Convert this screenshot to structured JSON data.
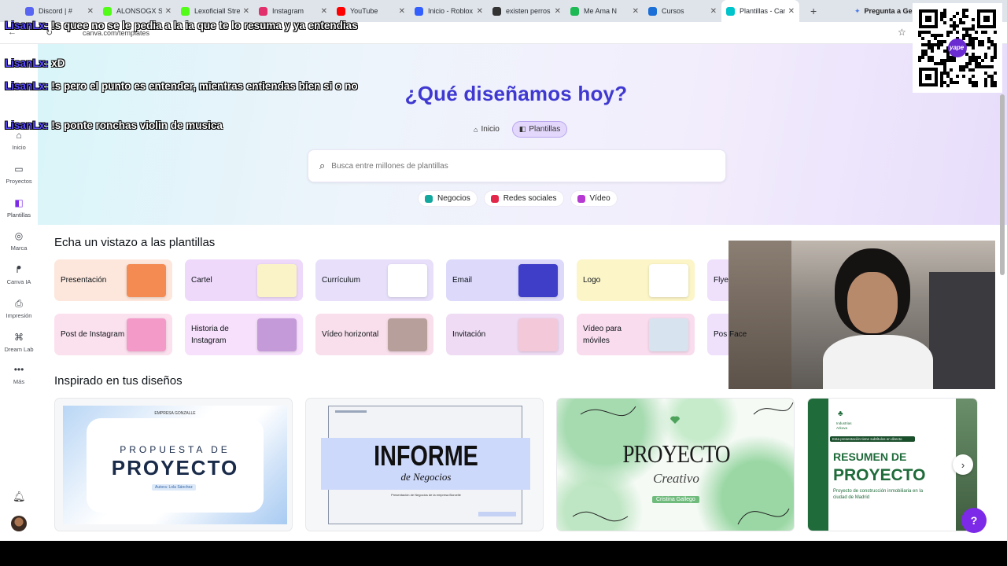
{
  "browser": {
    "tabs": [
      {
        "title": "Discord | #",
        "color": "#5865f2"
      },
      {
        "title": "ALONSOGX St",
        "color": "#53fc18"
      },
      {
        "title": "Lexoficiall Stre",
        "color": "#53fc18"
      },
      {
        "title": "Instagram",
        "color": "#e1306c"
      },
      {
        "title": "YouTube",
        "color": "#ff0000"
      },
      {
        "title": "Inicio - Roblox",
        "color": "#335fff"
      },
      {
        "title": "existen perros",
        "color": "#333333"
      },
      {
        "title": "Me Ama N",
        "color": "#1db954"
      },
      {
        "title": "Cursos",
        "color": "#1b6fd6"
      },
      {
        "title": "Plantillas - Can",
        "color": "#00c4cc"
      }
    ],
    "ask_gemini": "Pregunta a Gem",
    "url": "canva.com/templates"
  },
  "sidebar": {
    "items": [
      {
        "label": "Inicio",
        "icon": "home-icon",
        "glyph": "⌂"
      },
      {
        "label": "Proyectos",
        "icon": "folder-icon",
        "glyph": "▭"
      },
      {
        "label": "Plantillas",
        "icon": "templates-icon",
        "glyph": "◧"
      },
      {
        "label": "Marca",
        "icon": "brand-icon",
        "glyph": "◎"
      },
      {
        "label": "Canva IA",
        "icon": "ai-icon",
        "glyph": "ᖰ"
      },
      {
        "label": "Impresión",
        "icon": "print-icon",
        "glyph": "⎙"
      },
      {
        "label": "Dream Lab",
        "icon": "dreamlab-icon",
        "glyph": "⌘"
      },
      {
        "label": "Más",
        "icon": "more-icon",
        "glyph": "•••"
      }
    ]
  },
  "hero": {
    "title": "¿Qué diseñamos hoy?",
    "pill_home": "Inicio",
    "pill_templates": "Plantillas",
    "search_placeholder": "Busca entre millones de plantillas",
    "categories": [
      {
        "label": "Negocios",
        "color": "#13a89e"
      },
      {
        "label": "Redes sociales",
        "color": "#e3274b"
      },
      {
        "label": "Vídeo",
        "color": "#b63ad1"
      }
    ]
  },
  "templates_section": {
    "title": "Echa un vistazo a las plantillas",
    "row1": [
      {
        "label": "Presentación",
        "bg": "#fde7dc",
        "thumb": "#f48b53"
      },
      {
        "label": "Cartel",
        "bg": "#efd9fb",
        "thumb": "#fbf3c8"
      },
      {
        "label": "Currículum",
        "bg": "#e8e0fb",
        "thumb": "#ffffff"
      },
      {
        "label": "Email",
        "bg": "#dcd9fb",
        "thumb": "#3f3ec8"
      },
      {
        "label": "Logo",
        "bg": "#fbf5c8",
        "thumb": "#ffffff"
      },
      {
        "label": "Flye",
        "bg": "#efe0fb",
        "thumb": "#e7d8fb"
      }
    ],
    "row2": [
      {
        "label": "Post de Instagram",
        "bg": "#fbe0ee",
        "thumb": "#f49ac9"
      },
      {
        "label": "Historia de Instagram",
        "bg": "#f7e0fb",
        "thumb": "#c49bd8"
      },
      {
        "label": "Vídeo horizontal",
        "bg": "#f8dfeb",
        "thumb": "#b7a09b"
      },
      {
        "label": "Invitación",
        "bg": "#efdbf4",
        "thumb": "#f3c8d9"
      },
      {
        "label": "Vídeo para móviles",
        "bg": "#f9dcee",
        "thumb": "#d8e3f0"
      },
      {
        "label": "Pos Face",
        "bg": "#efe0fb",
        "thumb": "#e7d8fb"
      }
    ]
  },
  "inspired_section": {
    "title": "Inspirado en tus diseños",
    "cards": [
      {
        "kicker": "EMPRESA GONZALLE",
        "top": "PROPUESTA DE",
        "main": "PROYECTO",
        "author": "Autora: Lola Sánchez"
      },
      {
        "main": "INFORME",
        "sub": "de Negocios",
        "small": "Presentación de Negocios de la empresa Borcelle"
      },
      {
        "main": "PROYECTO",
        "sub": "Creativo",
        "author": "Cristina Gallego"
      },
      {
        "brand": "Industrias Arkova",
        "note": "Esta presentación tiene subtítulos en directo",
        "top": "RESUMEN DE",
        "main": "PROYECTO",
        "small": "Proyecto de construcción inmobiliaria en la ciudad de Madrid"
      }
    ]
  },
  "chat": [
    {
      "user": "LisanLx:",
      "text": "!s quee no se le pedia a la ia que te lo resuma y ya entendias"
    },
    {
      "user": "LisanLx:",
      "text": "xD"
    },
    {
      "user": "LisanLx:",
      "text": "!s pero el punto es entender, mientras entiendas bien si o no"
    },
    {
      "user": "LisanLx:",
      "text": "!s ponte ronchas violin de musica"
    }
  ],
  "help_label": "?",
  "qr_label": "yape"
}
